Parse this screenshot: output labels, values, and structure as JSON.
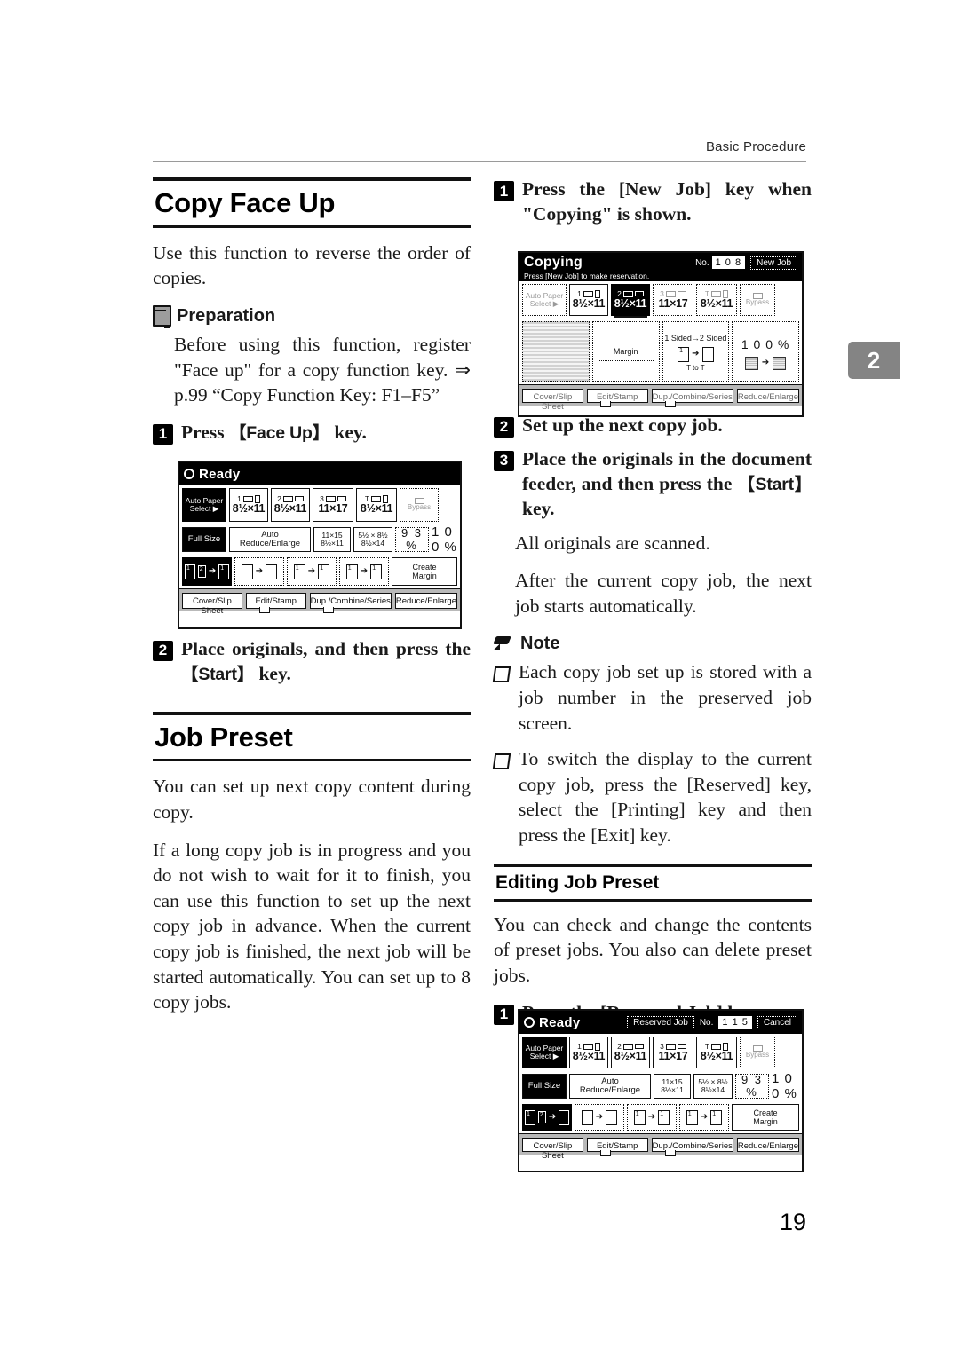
{
  "page": {
    "running_head": "Basic Procedure",
    "chapter_tab": "2",
    "page_number": "19"
  },
  "left_column": {
    "section1": {
      "heading": "Copy Face Up",
      "intro": "Use this function to reverse the order of copies.",
      "preparation": {
        "icon": "book-icon",
        "label": "Preparation",
        "text": "Before using this function, register \"Face up\" for a copy function key. ⇒ p.99 “Copy Function Key: F1–F5”"
      },
      "steps": [
        {
          "num": "1",
          "text_before": "Press ",
          "key": "Face Up",
          "text_after": " key."
        },
        {
          "num": "2",
          "text_before": "Place originals, and then press the ",
          "key": "Start",
          "text_after": " key."
        }
      ]
    },
    "section2": {
      "heading": "Job Preset",
      "paragraphs": [
        "You can set up next copy content during copy.",
        "If a long copy job is in progress and you do not wish to wait for it to finish, you can use this function to set up the next copy job in advance. When the current copy job is finished, the next job will be started automatically. You can set up to 8 copy jobs."
      ]
    }
  },
  "right_column": {
    "steps": [
      {
        "num": "1",
        "text": "Press the [New Job] key when \"Copying\" is shown.",
        "key": "New Job"
      },
      {
        "num": "2",
        "text": "Set up the next copy job."
      },
      {
        "num": "3",
        "text_before": "Place the originals in the document feeder, and then press the ",
        "key": "Start",
        "text_after": " key."
      }
    ],
    "after_step3": [
      "All originals are scanned.",
      "After the current copy job, the next job starts automatically."
    ],
    "note": {
      "icon": "pencil-icon",
      "label": "Note",
      "items": [
        "Each copy job set up is stored with a job number in the preserved job screen.",
        "To switch the display to the current copy job, press the [Reserved] key, select the [Printing] key and then press the [Exit] key."
      ],
      "item2_keys": [
        "Re-served",
        "Printing",
        "Exit"
      ]
    },
    "section3": {
      "heading": "Editing Job Preset",
      "paragraph": "You can check and change the contents of preset jobs. You also can delete preset jobs.",
      "step": {
        "num": "1",
        "text": "Press the [Reserved Job] key.",
        "key": "Reserved Job"
      }
    }
  },
  "lcd_ready_1": {
    "name": "operation-panel-ready",
    "title": "Ready",
    "power_icon": "power-icon",
    "paper_keys": [
      {
        "tray": "1",
        "size": "8½×11",
        "orient": "portrait",
        "selected": false
      },
      {
        "tray": "2",
        "size": "8½×11",
        "orient": "landscape",
        "selected": false
      },
      {
        "tray": "3",
        "size": "11×17",
        "orient": "landscape",
        "selected": false
      },
      {
        "tray": "T",
        "size": "8½×11",
        "orient": "portrait",
        "selected": false
      }
    ],
    "auto_paper_select": "Auto Paper Select ▶",
    "bypass": "Bypass",
    "ratio_keys": [
      {
        "label": "Full Size",
        "selected": true
      },
      {
        "label": "Auto Reduce/Enlarge",
        "selected": false
      },
      {
        "label": "11×15\n8½×11",
        "selected": false
      },
      {
        "label": "5½ × 8½\n8½×14",
        "selected": false
      },
      {
        "label": "9 3 %",
        "selected": false
      }
    ],
    "zoom_value": "1 0 0 %",
    "duplex_keys": [
      {
        "label": "1 2 → 1/2",
        "selected": true
      },
      {
        "label": "1/2 → 1/2",
        "selected": false
      },
      {
        "label": "1 2 → 1 2",
        "selected": false
      },
      {
        "label": "1 2 → 1 2 3 4",
        "selected": false
      }
    ],
    "create_margin": "Create Margin",
    "bottom_tabs": [
      "Cover/Slip Sheet",
      "Edit/Stamp",
      "Dup./Combine/Series",
      "Reduce/Enlarge"
    ]
  },
  "lcd_copying": {
    "name": "operation-panel-copying",
    "title": "Copying",
    "subtitle": "Press [New Job] to make reservation.",
    "job_no_label": "No.",
    "job_no": "1 0 8",
    "new_job_button": "New Job",
    "auto_paper_select": "Auto Paper Select ▶",
    "paper_keys": [
      {
        "tray": "1",
        "size": "8½×11",
        "selected": false
      },
      {
        "tray": "2",
        "size": "8½×11",
        "selected": true
      },
      {
        "tray": "3",
        "size": "11×17",
        "selected": false
      },
      {
        "tray": "T",
        "size": "8½×11",
        "selected": false
      }
    ],
    "bypass": "Bypass",
    "status_cells": [
      {
        "label": ""
      },
      {
        "label": "Margin"
      },
      {
        "label": "1 Sided→2 Sided",
        "sub": "T to T"
      },
      {
        "label": "1 0 0 %"
      }
    ],
    "bottom_tabs": [
      "Cover/Slip Sheet",
      "Edit/Stamp",
      "Dup./Combine/Series",
      "Reduce/Enlarge"
    ]
  },
  "lcd_ready_2": {
    "name": "operation-panel-reserved-job",
    "title": "Ready",
    "reserved_job_button": "Reserved Job",
    "job_no_label": "No.",
    "job_no": "1 1 5",
    "cancel_button": "Cancel",
    "auto_paper_select": "Auto Paper Select ▶",
    "paper_keys": [
      {
        "tray": "1",
        "size": "8½×11"
      },
      {
        "tray": "2",
        "size": "8½×11"
      },
      {
        "tray": "3",
        "size": "11×17"
      },
      {
        "tray": "T",
        "size": "8½×11"
      }
    ],
    "bypass": "Bypass",
    "ratio_keys": [
      {
        "label": "Full Size",
        "selected": true
      },
      {
        "label": "Auto Reduce/Enlarge",
        "selected": false
      },
      {
        "label": "11×15\n8½×11",
        "selected": false
      },
      {
        "label": "5½ × 8½\n8½×14",
        "selected": false
      },
      {
        "label": "9 3 %",
        "selected": false
      }
    ],
    "zoom_value": "1 0 0 %",
    "create_margin": "Create Margin",
    "bottom_tabs": [
      "Cover/Slip Sheet",
      "Edit/Stamp",
      "Dup./Combine/Series",
      "Reduce/Enlarge"
    ]
  },
  "colors": {
    "ink": "#111111",
    "tab_gray": "#848484",
    "rule_gray": "#9a9a9a"
  }
}
